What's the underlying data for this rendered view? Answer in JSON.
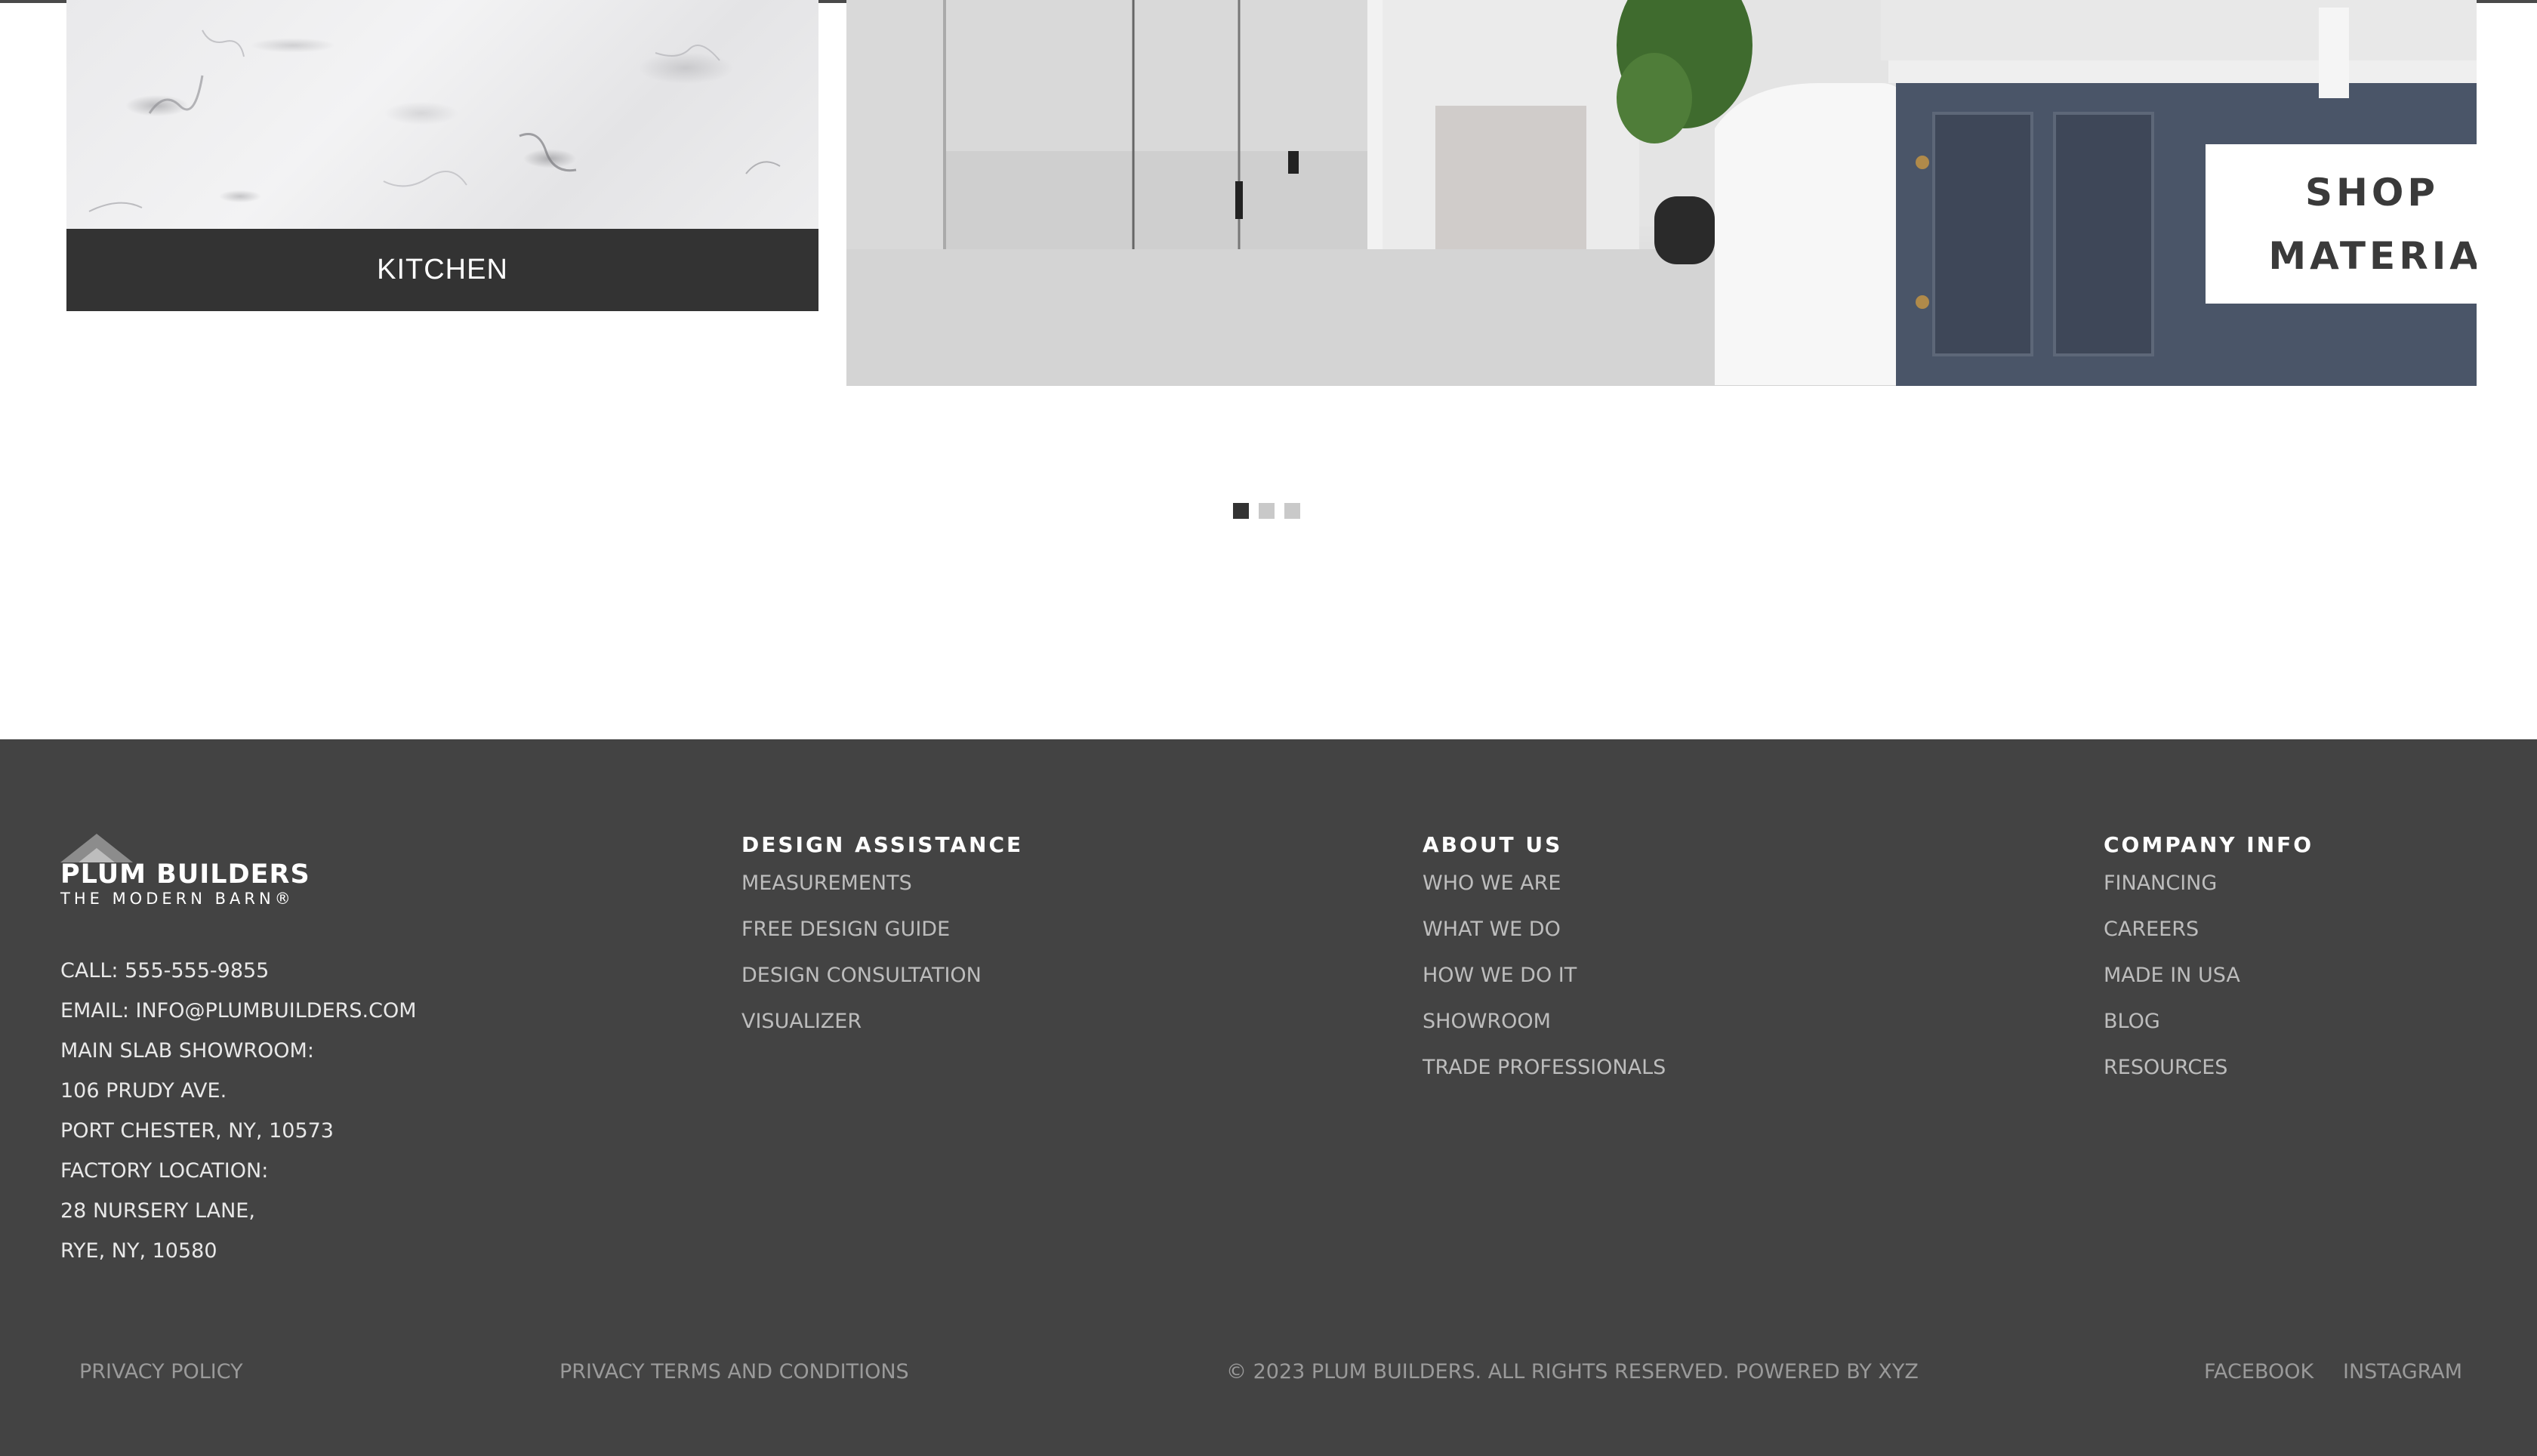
{
  "carousel": {
    "kitchen_label": "KITCHEN",
    "shop_line1": "SHOP",
    "shop_line2": "MATERIA",
    "pagination": {
      "total": 3,
      "active": 1
    }
  },
  "footer": {
    "logo": {
      "name": "PLUM BUILDERS",
      "tagline": "THE MODERN BARN®"
    },
    "contact": [
      "CALL: 555-555-9855",
      "EMAIL: INFO@PLUMBUILDERS.COM",
      "MAIN SLAB SHOWROOM:",
      "106 PRUDY AVE.",
      "PORT CHESTER, NY, 10573",
      "FACTORY LOCATION:",
      "28 NURSERY LANE,",
      "RYE, NY, 10580"
    ],
    "columns": [
      {
        "title": "DESIGN ASSISTANCE",
        "links": [
          "MEASUREMENTS",
          "FREE DESIGN GUIDE",
          "DESIGN CONSULTATION",
          "VISUALIZER"
        ]
      },
      {
        "title": "ABOUT US",
        "links": [
          "WHO WE ARE",
          "WHAT WE DO",
          "HOW WE DO IT",
          "SHOWROOM",
          "TRADE PROFESSIONALS"
        ]
      },
      {
        "title": "COMPANY INFO",
        "links": [
          "FINANCING",
          "CAREERS",
          "MADE IN USA",
          "BLOG",
          "RESOURCES"
        ]
      }
    ],
    "bottom": {
      "privacy_policy": "PRIVACY POLICY",
      "terms": "PRIVACY TERMS AND CONDITIONS",
      "copyright": "© 2023 PLUM BUILDERS. ALL RIGHTS RESERVED. POWERED BY XYZ",
      "facebook": "FACEBOOK",
      "instagram": "INSTAGRAM"
    }
  },
  "colors": {
    "footer_bg": "#434343",
    "dark_bar": "#333333",
    "link_muted": "#bdbdbd"
  }
}
